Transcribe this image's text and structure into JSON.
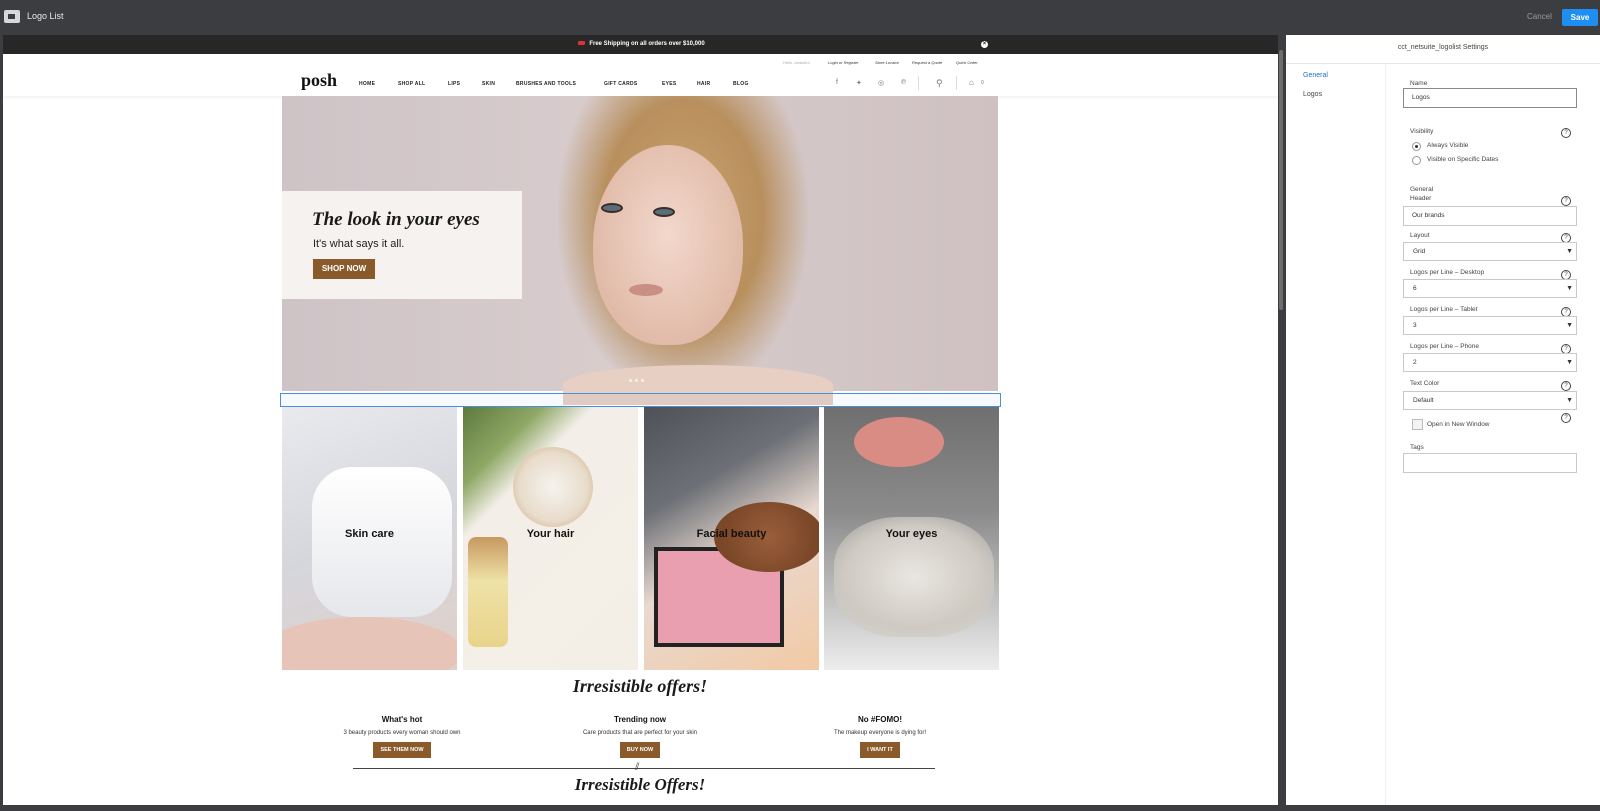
{
  "window": {
    "title": "Logo List",
    "cancel_label": "Cancel",
    "save_label": "Save"
  },
  "store": {
    "promo": "Free Shipping on all orders over $10,000",
    "utility": [
      "Hello, beautiful",
      "Login or Register",
      "Store Locator",
      "Request a Quote",
      "Quick Order"
    ],
    "logo": "posh",
    "nav": [
      "HOME",
      "SHOP ALL",
      "LIPS",
      "SKIN",
      "BRUSHES AND TOOLS",
      "GIFT CARDS",
      "EYES",
      "HAIR",
      "BLOG"
    ],
    "social_icons": [
      "facebook-icon",
      "twitter-icon",
      "instagram-icon",
      "pinterest-icon"
    ],
    "cart_count": "0",
    "hero": {
      "title": "The look in your eyes",
      "subtitle": "It's what says it all.",
      "button": "SHOP NOW"
    },
    "categories": [
      "Skin care",
      "Your hair",
      "Facial beauty",
      "Your eyes"
    ],
    "offers_title": "Irresistible offers!",
    "offers": [
      {
        "title": "What's hot",
        "desc": "3 beauty products every woman should own",
        "button": "SEE THEM NOW"
      },
      {
        "title": "Trending now",
        "desc": "Care products that are perfect for your skin",
        "button": "BUY NOW"
      },
      {
        "title": "No #FOMO!",
        "desc": "The makeup everyone is dying for!",
        "button": "I WANT IT"
      }
    ],
    "offers_title_2": "Irresistible Offers!"
  },
  "settings": {
    "title": "cct_netsuite_logolist Settings",
    "nav": [
      "General",
      "Logos"
    ],
    "name_label": "Name",
    "name_value": "Logos",
    "visibility_label": "Visibility",
    "visibility_options": [
      "Always Visible",
      "Visible on Specific Dates"
    ],
    "header_label_1": "General",
    "header_label_2": "Header",
    "header_value": "Our brands",
    "layout_label": "Layout",
    "layout_value": "Grid",
    "desktop_label": "Logos per Line – Desktop",
    "desktop_value": "6",
    "tablet_label": "Logos per Line – Tablet",
    "tablet_value": "3",
    "phone_label": "Logos per Line – Phone",
    "phone_value": "2",
    "textcolor_label": "Text Color",
    "textcolor_value": "Default",
    "newwindow_label": "Open in New Window",
    "tags_label": "Tags",
    "tags_value": ""
  },
  "colors": {
    "accent": "#1e8ef0",
    "brand_button": "#8b5a2b",
    "chrome": "#3c3d40"
  }
}
